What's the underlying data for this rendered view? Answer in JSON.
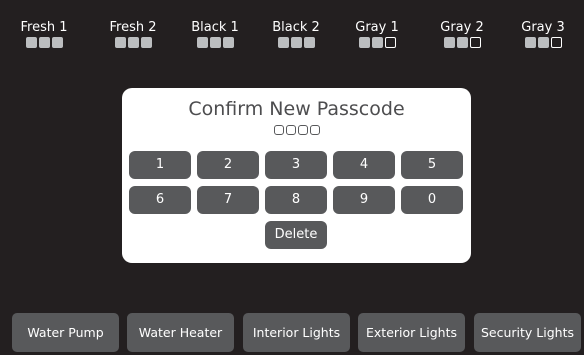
{
  "tanks": [
    {
      "label": "Fresh 1",
      "level": 1.0
    },
    {
      "label": "Fresh 2",
      "level": 1.0
    },
    {
      "label": "Black 1",
      "level": 1.0
    },
    {
      "label": "Black 2",
      "level": 1.0
    },
    {
      "label": "Gray 1",
      "level": 0.6667
    },
    {
      "label": "Gray 2",
      "level": 0.6667
    },
    {
      "label": "Gray 3",
      "level": 0.6667
    }
  ],
  "dialog": {
    "title": "Confirm New Passcode",
    "entered_digits": 0,
    "passcode_length": 4,
    "keys_row1": [
      "1",
      "2",
      "3",
      "4",
      "5"
    ],
    "keys_row2": [
      "6",
      "7",
      "8",
      "9",
      "0"
    ],
    "delete_label": "Delete"
  },
  "controls": [
    "Water Pump",
    "Water Heater",
    "Interior Lights",
    "Exterior Lights",
    "Security Lights"
  ],
  "colors": {
    "background": "#231f20",
    "button": "#58595b",
    "level_filled": "#bcbec0",
    "dialog": "#ffffff"
  }
}
